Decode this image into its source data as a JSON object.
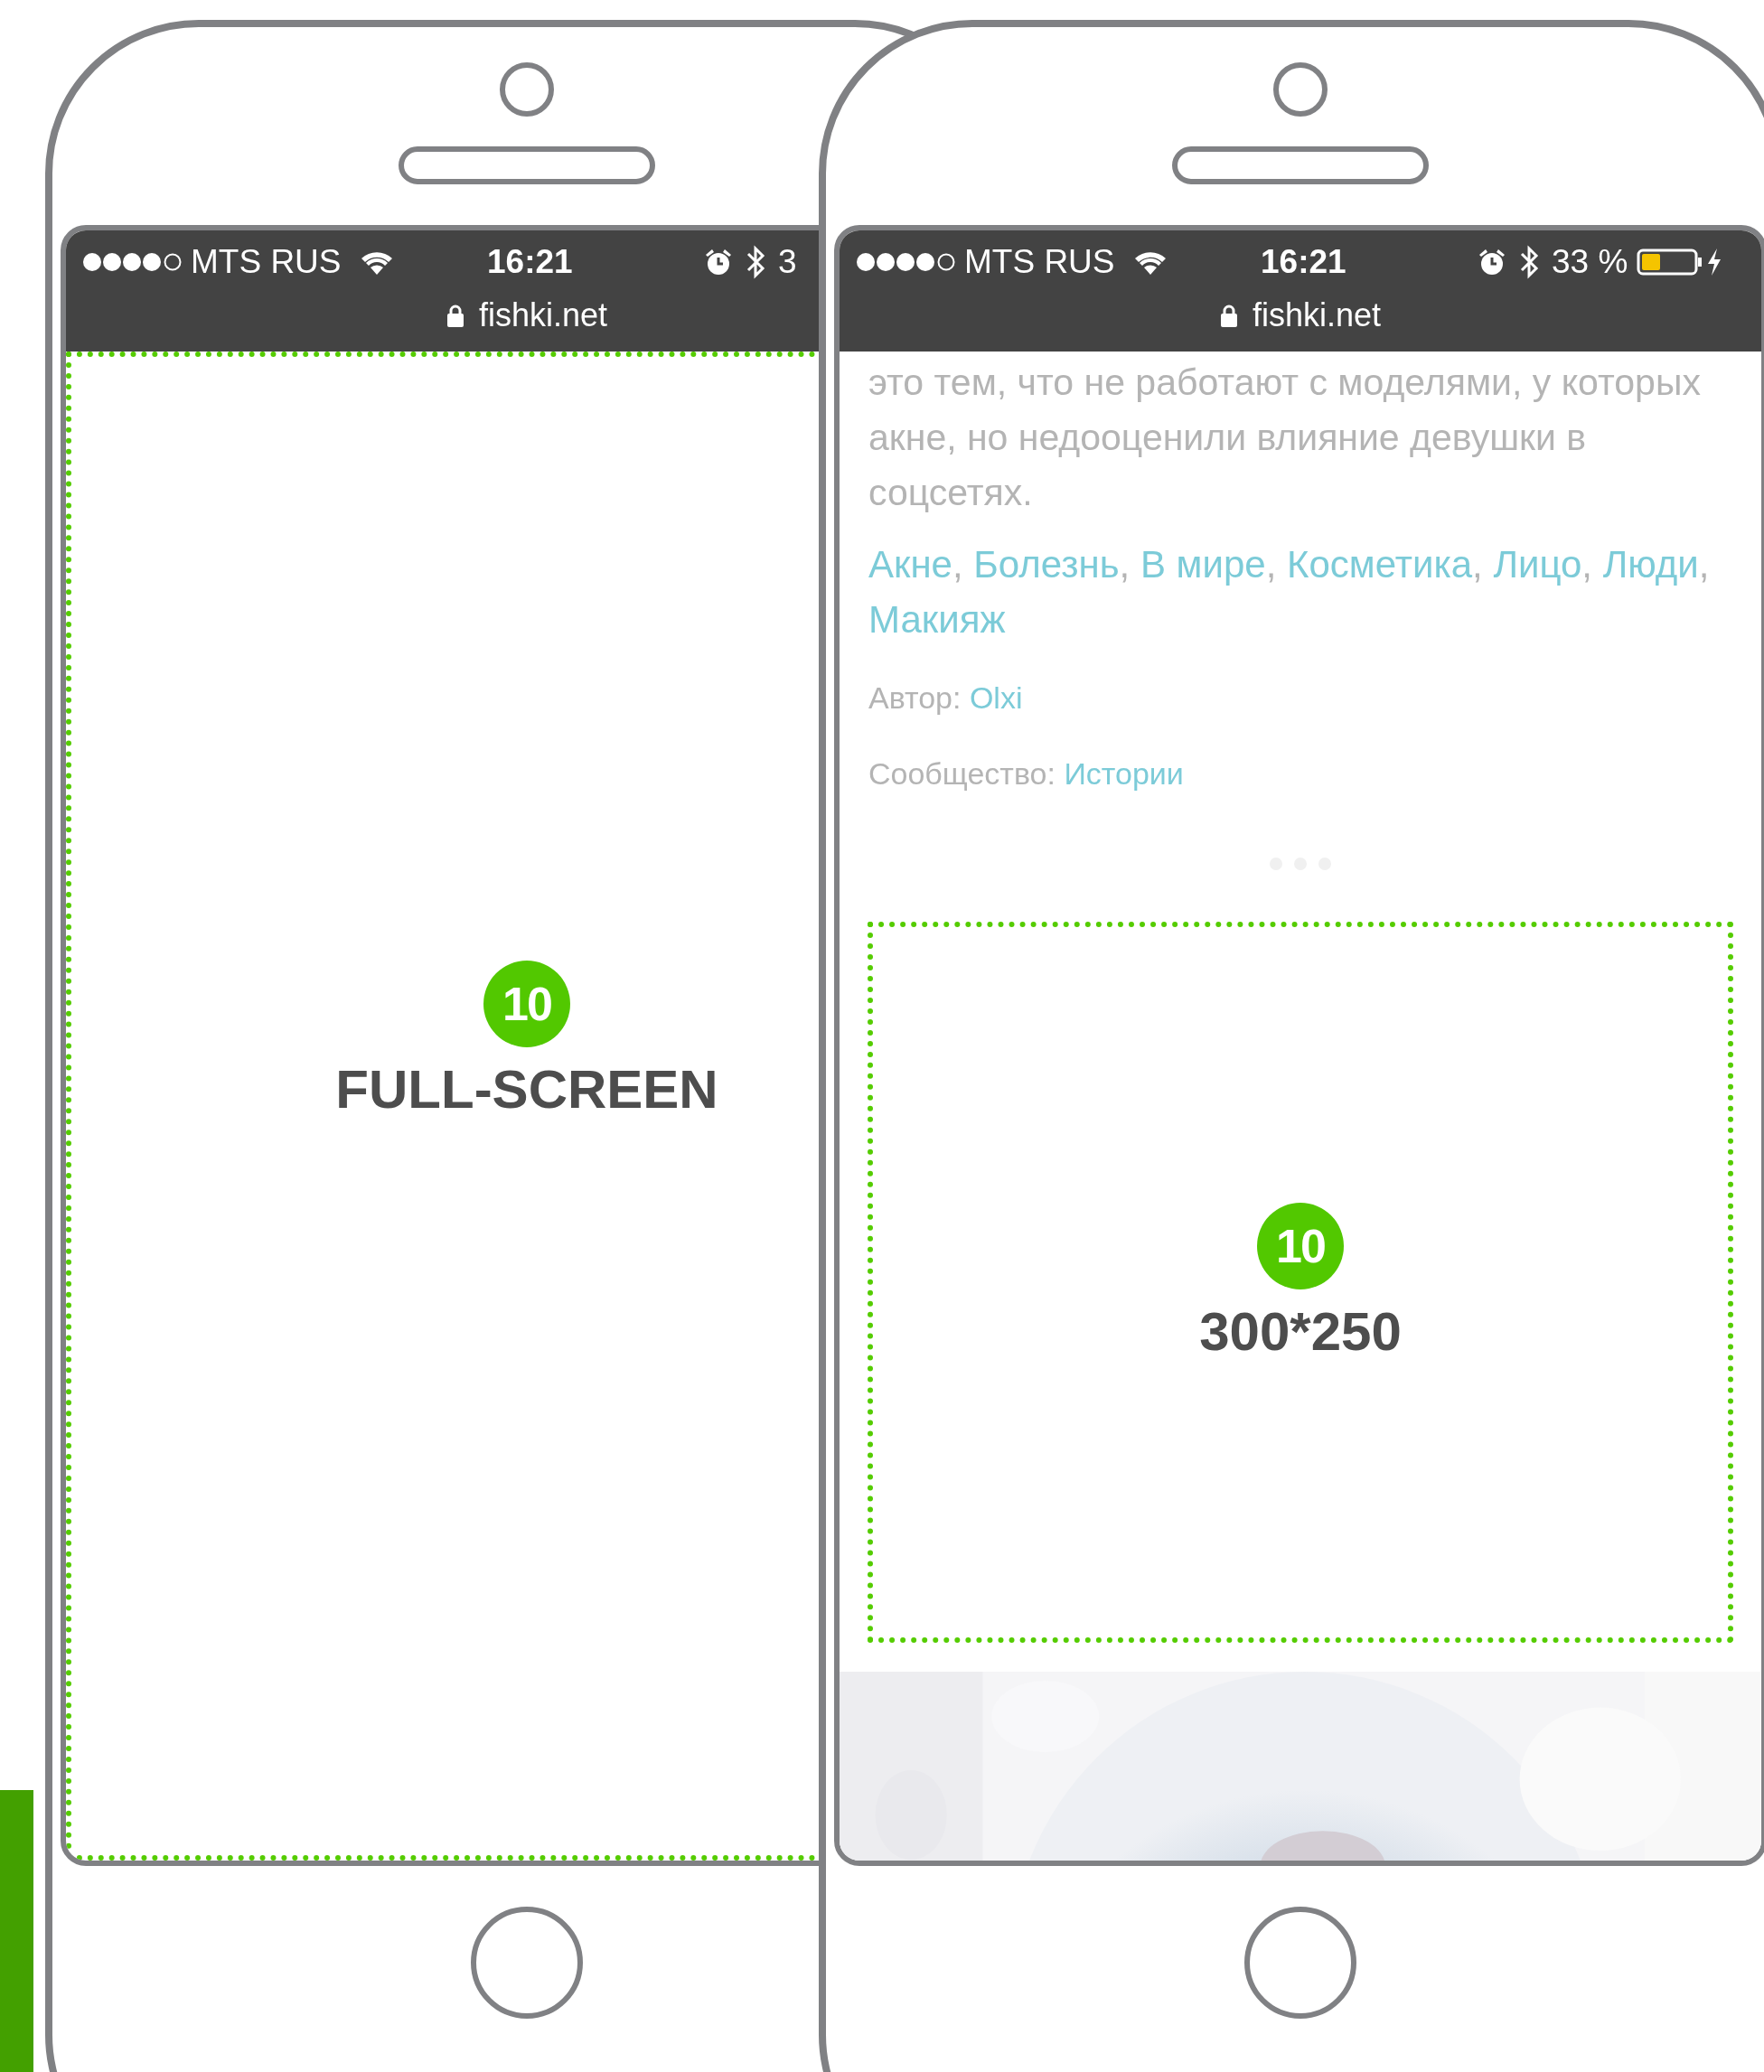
{
  "phones": [
    {
      "kind": "fullscreen",
      "status_bar": {
        "carrier": "MTS RUS",
        "time": "16:21",
        "battery": "3"
      },
      "url": "fishki.net",
      "ad": {
        "badge": "10",
        "label": "FULL-SCREEN"
      }
    },
    {
      "kind": "article",
      "status_bar": {
        "carrier": "MTS RUS",
        "time": "16:21",
        "battery": "33 %"
      },
      "url": "fishki.net",
      "article": {
        "paragraph": "это тем, что не работают с моделями, у которых акне, но недооценили влияние девушки в соцсетях.",
        "tags": [
          {
            "label": "Акне",
            "sep": ","
          },
          {
            "label": "Болезнь",
            "sep": ","
          },
          {
            "label": "В мире",
            "sep": ","
          },
          {
            "label": "Косметика",
            "sep": ","
          },
          {
            "label": "Лицо",
            "sep": ","
          },
          {
            "label": "Люди",
            "sep": ","
          },
          {
            "label": "Макияж"
          }
        ],
        "author_label": "Автор:",
        "author": "Olxi",
        "community_label": "Сообщество:",
        "community": "Истории"
      },
      "ad": {
        "badge": "10",
        "label": "300*250"
      }
    }
  ]
}
